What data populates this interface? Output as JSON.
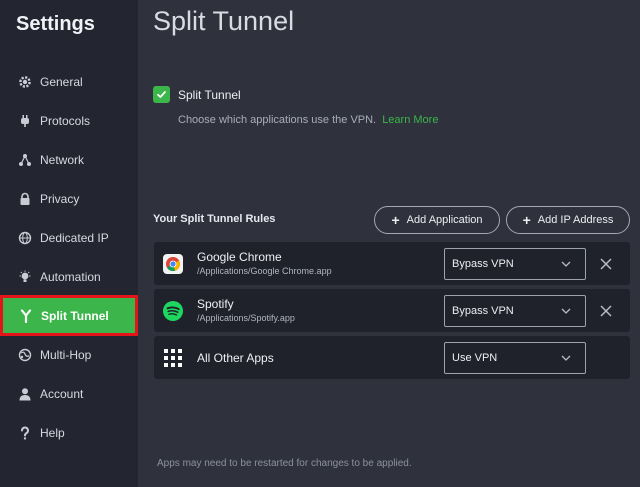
{
  "app_title": "Settings",
  "sidebar": {
    "items": [
      {
        "label": "General",
        "icon": "gear-icon"
      },
      {
        "label": "Protocols",
        "icon": "plug-icon"
      },
      {
        "label": "Network",
        "icon": "network-icon"
      },
      {
        "label": "Privacy",
        "icon": "lock-icon"
      },
      {
        "label": "Dedicated IP",
        "icon": "globe-icon"
      },
      {
        "label": "Automation",
        "icon": "lightbulb-icon"
      },
      {
        "label": "Split Tunnel",
        "icon": "split-tunnel-icon",
        "active": true
      },
      {
        "label": "Multi-Hop",
        "icon": "multihop-globe-icon"
      },
      {
        "label": "Account",
        "icon": "user-icon"
      },
      {
        "label": "Help",
        "icon": "question-icon"
      }
    ]
  },
  "main": {
    "page_title": "Split Tunnel",
    "toggle": {
      "label": "Split Tunnel",
      "checked": true
    },
    "description": "Choose which applications use the VPN.",
    "learn_more": "Learn More",
    "rules_heading": "Your Split Tunnel Rules",
    "add_application_label": "Add Application",
    "add_ip_label": "Add IP Address",
    "rules": [
      {
        "name": "Google Chrome",
        "path": "/Applications/Google Chrome.app",
        "mode": "Bypass VPN",
        "icon": "chrome-icon",
        "removable": true
      },
      {
        "name": "Spotify",
        "path": "/Applications/Spotify.app",
        "mode": "Bypass VPN",
        "icon": "spotify-icon",
        "removable": true
      },
      {
        "name": "All Other Apps",
        "path": "",
        "mode": "Use VPN",
        "icon": "grid-icon",
        "removable": false
      }
    ],
    "footer_note": "Apps may need to be restarted for changes to be applied."
  },
  "colors": {
    "accent": "#3cb54a",
    "highlight_border": "#e3151a",
    "sidebar_bg": "#232630",
    "main_bg": "#2f323d"
  }
}
